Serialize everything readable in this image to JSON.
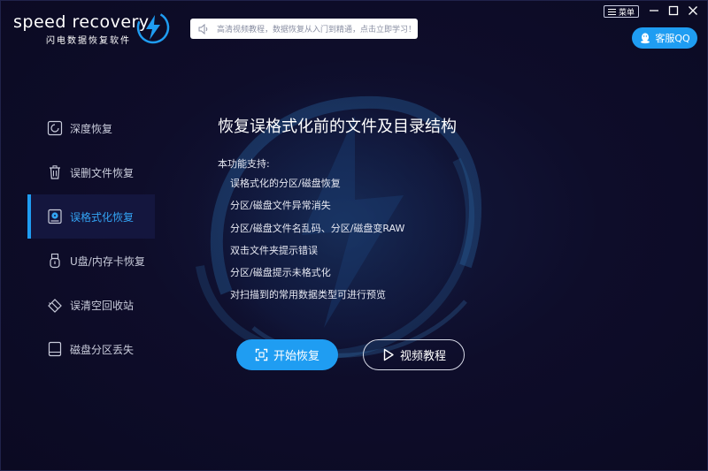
{
  "app": {
    "logo_text": "speed recovery",
    "logo_subtitle": "闪电数据恢复软件"
  },
  "notice": {
    "text": "高清视频教程，数据恢复从入门到精通，点击立即学习！",
    "icon": "speaker-icon"
  },
  "titlebar": {
    "menu_label": "菜单",
    "qq_label": "客服QQ"
  },
  "sidebar": {
    "items": [
      {
        "label": "深度恢复",
        "icon": "deep-recovery-icon"
      },
      {
        "label": "误删文件恢复",
        "icon": "trash-icon"
      },
      {
        "label": "误格式化恢复",
        "icon": "format-disk-icon"
      },
      {
        "label": "U盘/内存卡恢复",
        "icon": "usb-icon"
      },
      {
        "label": "误清空回收站",
        "icon": "eraser-icon"
      },
      {
        "label": "磁盘分区丢失",
        "icon": "disk-icon"
      }
    ],
    "active_index": 2
  },
  "main": {
    "title": "恢复误格式化前的文件及目录结构",
    "support_label": "本功能支持:",
    "features": [
      "误格式化的分区/磁盘恢复",
      "分区/磁盘文件异常消失",
      "分区/磁盘文件名乱码、分区/磁盘变RAW",
      "双击文件夹提示错误",
      "分区/磁盘提示未格式化",
      "对扫描到的常用数据类型可进行预览"
    ],
    "start_button": "开始恢复",
    "video_button": "视频教程"
  },
  "colors": {
    "accent": "#1f9df2",
    "background": "#0d0c26",
    "sidebar_active_bg": "#14163e"
  }
}
